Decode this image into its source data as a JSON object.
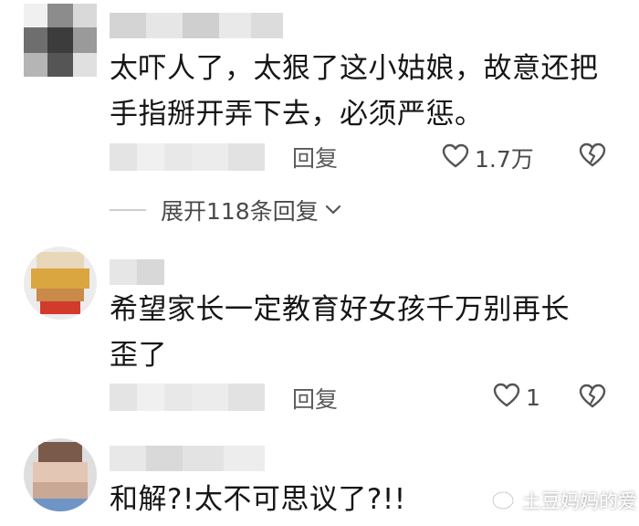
{
  "comments": [
    {
      "text_line1": "太吓人了，太狠了这小姑娘，故意还把",
      "text_line2": "手指掰开弄下去，必须严惩。",
      "reply_label": "回复",
      "likes": "1.7万",
      "expand_label": "展开118条回复"
    },
    {
      "text_line1": "希望家长一定教育好女孩千万别再长",
      "text_line2": "歪了",
      "reply_label": "回复",
      "likes": "1"
    },
    {
      "text_line1": "和解?!太不可思议了?!!"
    }
  ],
  "watermark": {
    "text": "土豆妈妈的爱"
  },
  "icons": {
    "like": "heart-outline-icon",
    "dislike": "broken-heart-icon",
    "expand": "chevron-down-icon",
    "watermark": "wechat-channel-icon"
  },
  "colors": {
    "text": "#161616",
    "secondary": "#5a5a5a",
    "icon": "#555555"
  }
}
